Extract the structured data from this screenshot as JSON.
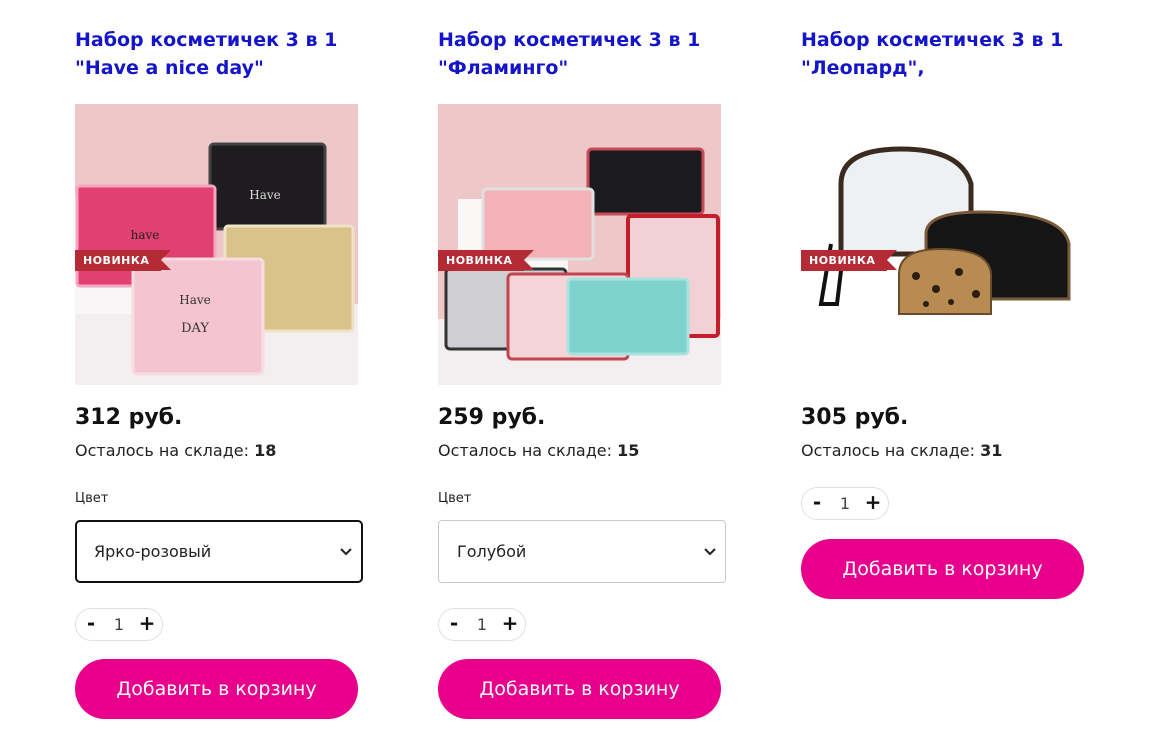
{
  "products": [
    {
      "title_line1": "Набор косметичек 3 в 1",
      "title_line2": "\"Have a nice day\"",
      "badge": "НОВИНКА",
      "price": "312 руб.",
      "stock_label": "Осталось на складе:",
      "stock_count": "18",
      "color_label": "Цвет",
      "color_value": "Ярко-розовый",
      "qty_minus": "-",
      "qty_value": "1",
      "qty_plus": "+",
      "add_label": "Добавить в корзину"
    },
    {
      "title_line1": "Набор косметичек 3 в 1",
      "title_line2": "\"Фламинго\"",
      "badge": "НОВИНКА",
      "price": "259 руб.",
      "stock_label": "Осталось на складе:",
      "stock_count": "15",
      "color_label": "Цвет",
      "color_value": "Голубой",
      "qty_minus": "-",
      "qty_value": "1",
      "qty_plus": "+",
      "add_label": "Добавить в корзину"
    },
    {
      "title_line1": "Набор косметичек 3 в 1",
      "title_line2": "\"Леопард\",",
      "badge": "НОВИНКА",
      "price": "305 руб.",
      "stock_label": "Осталось на складе:",
      "stock_count": "31",
      "qty_minus": "-",
      "qty_value": "1",
      "qty_plus": "+",
      "add_label": "Добавить в корзину"
    }
  ],
  "colors": {
    "title": "#1414c8",
    "button": "#e8008d",
    "badge": "#b52b35"
  }
}
